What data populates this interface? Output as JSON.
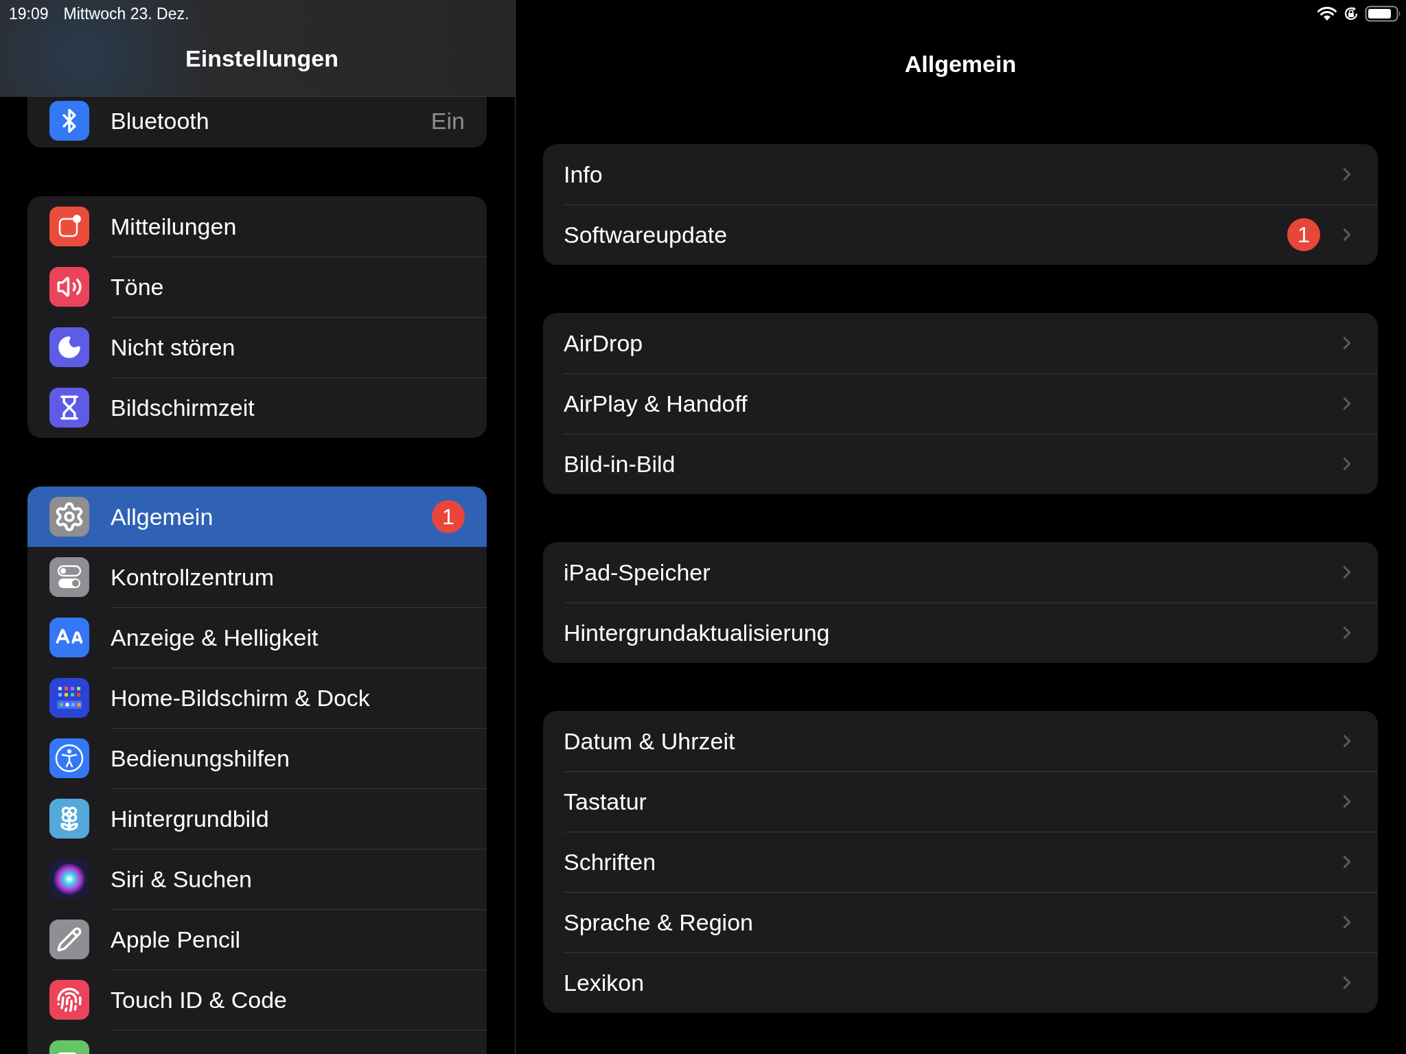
{
  "status_bar": {
    "time": "19:09",
    "date": "Mittwoch 23. Dez."
  },
  "sidebar": {
    "title": "Einstellungen",
    "groups": [
      {
        "items": [
          {
            "label": "Bluetooth",
            "value": "Ein",
            "selected": false
          }
        ]
      },
      {
        "items": [
          {
            "label": "Mitteilungen",
            "selected": false
          },
          {
            "label": "Töne",
            "selected": false
          },
          {
            "label": "Nicht stören",
            "selected": false
          },
          {
            "label": "Bildschirmzeit",
            "selected": false
          }
        ]
      },
      {
        "items": [
          {
            "label": "Allgemein",
            "badge": "1",
            "selected": true
          },
          {
            "label": "Kontrollzentrum",
            "selected": false
          },
          {
            "label": "Anzeige & Helligkeit",
            "selected": false
          },
          {
            "label": "Home-Bildschirm & Dock",
            "selected": false
          },
          {
            "label": "Bedienungshilfen",
            "selected": false
          },
          {
            "label": "Hintergrundbild",
            "selected": false
          },
          {
            "label": "Siri & Suchen",
            "selected": false
          },
          {
            "label": "Apple Pencil",
            "selected": false
          },
          {
            "label": "Touch ID & Code",
            "selected": false
          },
          {
            "selected": false
          }
        ]
      }
    ]
  },
  "detail": {
    "title": "Allgemein",
    "groups": [
      {
        "items": [
          {
            "label": "Info"
          },
          {
            "label": "Softwareupdate",
            "badge": "1"
          }
        ]
      },
      {
        "items": [
          {
            "label": "AirDrop"
          },
          {
            "label": "AirPlay & Handoff"
          },
          {
            "label": "Bild-in-Bild"
          }
        ]
      },
      {
        "items": [
          {
            "label": "iPad-Speicher"
          },
          {
            "label": "Hintergrundaktualisierung"
          }
        ]
      },
      {
        "items": [
          {
            "label": "Datum & Uhrzeit"
          },
          {
            "label": "Tastatur"
          },
          {
            "label": "Schriften"
          },
          {
            "label": "Sprache & Region"
          },
          {
            "label": "Lexikon"
          }
        ]
      }
    ]
  }
}
